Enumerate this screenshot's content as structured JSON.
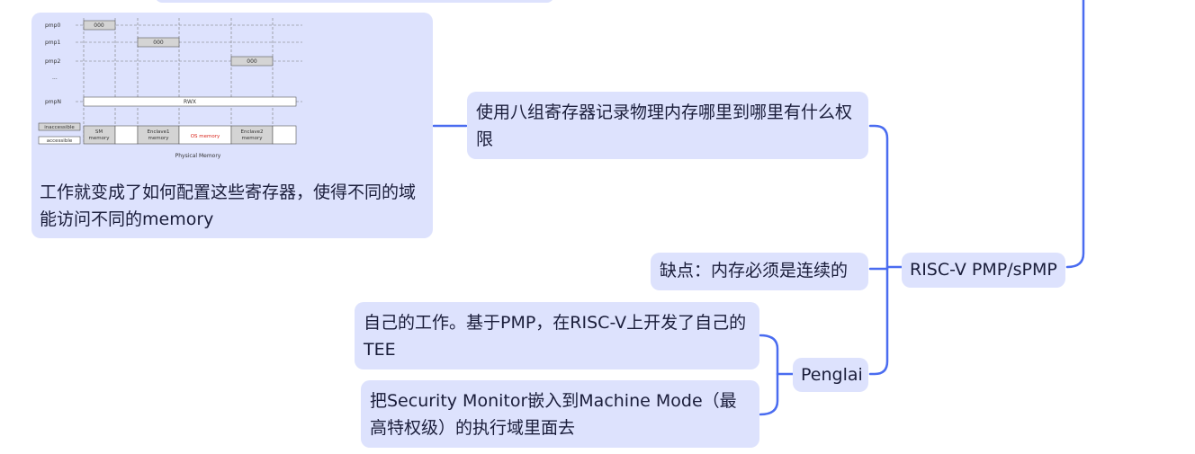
{
  "branch_color": "#4a6cf0",
  "node_color": "#dde2fd",
  "nodes": {
    "riscv": "RISC-V PMP/sPMP",
    "use_registers": "使用八组寄存器记录物理内存哪里到哪里有什么权限",
    "drawback": "缺点：内存必须是连续的",
    "penglai": "Penglai",
    "own_work": "自己的工作。基于PMP，在RISC-V上开发了自己的TEE",
    "security_monitor": "把Security Monitor嵌入到Machine Mode（最高特权级）的执行域里面去",
    "config_note": "工作就变成了如何配置这些寄存器，使得不同的域能访问不同的memory"
  },
  "pmp_figure": {
    "rows": [
      {
        "label": "pmp0",
        "box": "000"
      },
      {
        "label": "pmp1",
        "box": "000"
      },
      {
        "label": "pmp2",
        "box": "000"
      },
      {
        "label": "...",
        "box": ""
      },
      {
        "label": "pmpN",
        "box": "RWX"
      }
    ],
    "legend": {
      "inaccessible": "inaccessible",
      "accessible": "accessible"
    },
    "segments": [
      "SM\nmemory",
      "",
      "Enclave1\nmemory",
      "OS memory",
      "Enclave2\nmemory",
      ""
    ],
    "caption": "Physical Memory",
    "os_color": "#d9261c"
  }
}
